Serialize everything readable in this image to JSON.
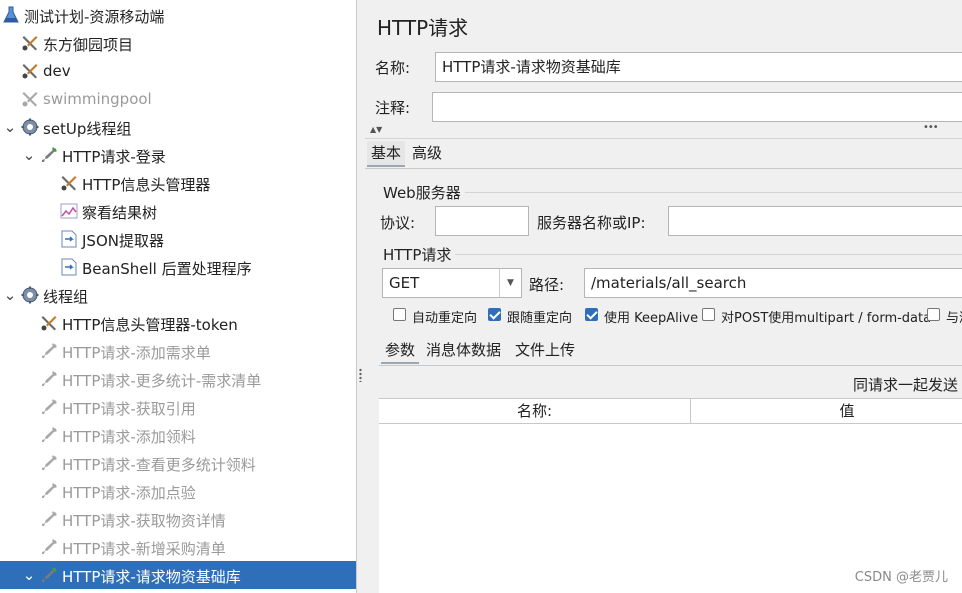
{
  "tree": {
    "nodes": [
      {
        "label": "测试计划-资源移动端",
        "icon": "flask-icon",
        "toggle": "",
        "disabled": false,
        "selected": false
      },
      {
        "label": "东方御园项目",
        "icon": "tools-icon",
        "toggle": "",
        "disabled": false,
        "selected": false
      },
      {
        "label": "dev",
        "icon": "tools-icon",
        "toggle": "",
        "disabled": false,
        "selected": false
      },
      {
        "label": "swimmingpool",
        "icon": "tools-icon",
        "toggle": "",
        "disabled": true,
        "selected": false
      },
      {
        "label": "setUp线程组",
        "icon": "gear-icon",
        "toggle": "expanded",
        "disabled": false,
        "selected": false
      },
      {
        "label": "HTTP请求-登录",
        "icon": "pipette-icon",
        "toggle": "expanded",
        "disabled": false,
        "selected": false
      },
      {
        "label": "HTTP信息头管理器",
        "icon": "tools-icon",
        "toggle": "",
        "disabled": false,
        "selected": false
      },
      {
        "label": "察看结果树",
        "icon": "chart-icon",
        "toggle": "",
        "disabled": false,
        "selected": false
      },
      {
        "label": "JSON提取器",
        "icon": "extractor-icon",
        "toggle": "",
        "disabled": false,
        "selected": false
      },
      {
        "label": "BeanShell 后置处理程序",
        "icon": "extractor-icon",
        "toggle": "",
        "disabled": false,
        "selected": false
      },
      {
        "label": "线程组",
        "icon": "gear-icon",
        "toggle": "expanded",
        "disabled": false,
        "selected": false
      },
      {
        "label": "HTTP信息头管理器-token",
        "icon": "tools-icon",
        "toggle": "",
        "disabled": false,
        "selected": false
      },
      {
        "label": "HTTP请求-添加需求单",
        "icon": "pipette-icon",
        "toggle": "",
        "disabled": true,
        "selected": false
      },
      {
        "label": "HTTP请求-更多统计-需求清单",
        "icon": "pipette-icon",
        "toggle": "",
        "disabled": true,
        "selected": false
      },
      {
        "label": "HTTP请求-获取引用",
        "icon": "pipette-icon",
        "toggle": "",
        "disabled": true,
        "selected": false
      },
      {
        "label": "HTTP请求-添加领料",
        "icon": "pipette-icon",
        "toggle": "",
        "disabled": true,
        "selected": false
      },
      {
        "label": "HTTP请求-查看更多统计领料",
        "icon": "pipette-icon",
        "toggle": "",
        "disabled": true,
        "selected": false
      },
      {
        "label": "HTTP请求-添加点验",
        "icon": "pipette-icon",
        "toggle": "",
        "disabled": true,
        "selected": false
      },
      {
        "label": "HTTP请求-获取物资详情",
        "icon": "pipette-icon",
        "toggle": "",
        "disabled": true,
        "selected": false
      },
      {
        "label": "HTTP请求-新增采购清单",
        "icon": "pipette-icon",
        "toggle": "",
        "disabled": true,
        "selected": false
      },
      {
        "label": "HTTP请求-请求物资基础库",
        "icon": "pipette-icon",
        "toggle": "expanded",
        "disabled": false,
        "selected": true
      }
    ]
  },
  "panel": {
    "title": "HTTP请求",
    "name_label": "名称:",
    "name_value": "HTTP请求-请求物资基础库",
    "comment_label": "注释:",
    "comment_value": "",
    "tabs": [
      "基本",
      "高级"
    ],
    "web_server": {
      "group_label": "Web服务器",
      "protocol_label": "协议:",
      "protocol_value": "",
      "server_label": "服务器名称或IP:",
      "server_value": ""
    },
    "http_request": {
      "group_label": "HTTP请求",
      "method": "GET",
      "path_label": "路径:",
      "path_value": "/materials/all_search"
    },
    "options": [
      {
        "label": "自动重定向",
        "checked": false
      },
      {
        "label": "跟随重定向",
        "checked": true
      },
      {
        "label": "使用 KeepAlive",
        "checked": true
      },
      {
        "label": "对POST使用multipart / form-data",
        "checked": false
      },
      {
        "label": "与浏",
        "checked": false
      }
    ],
    "sub_tabs": [
      "参数",
      "消息体数据",
      "文件上传"
    ],
    "send_with_request": "同请求一起发送",
    "table_headers": [
      "名称:",
      "值"
    ]
  },
  "watermark": "CSDN @老贾儿",
  "colors": {
    "selection": "#2f6fba",
    "checkbox": "#2f6fba"
  }
}
